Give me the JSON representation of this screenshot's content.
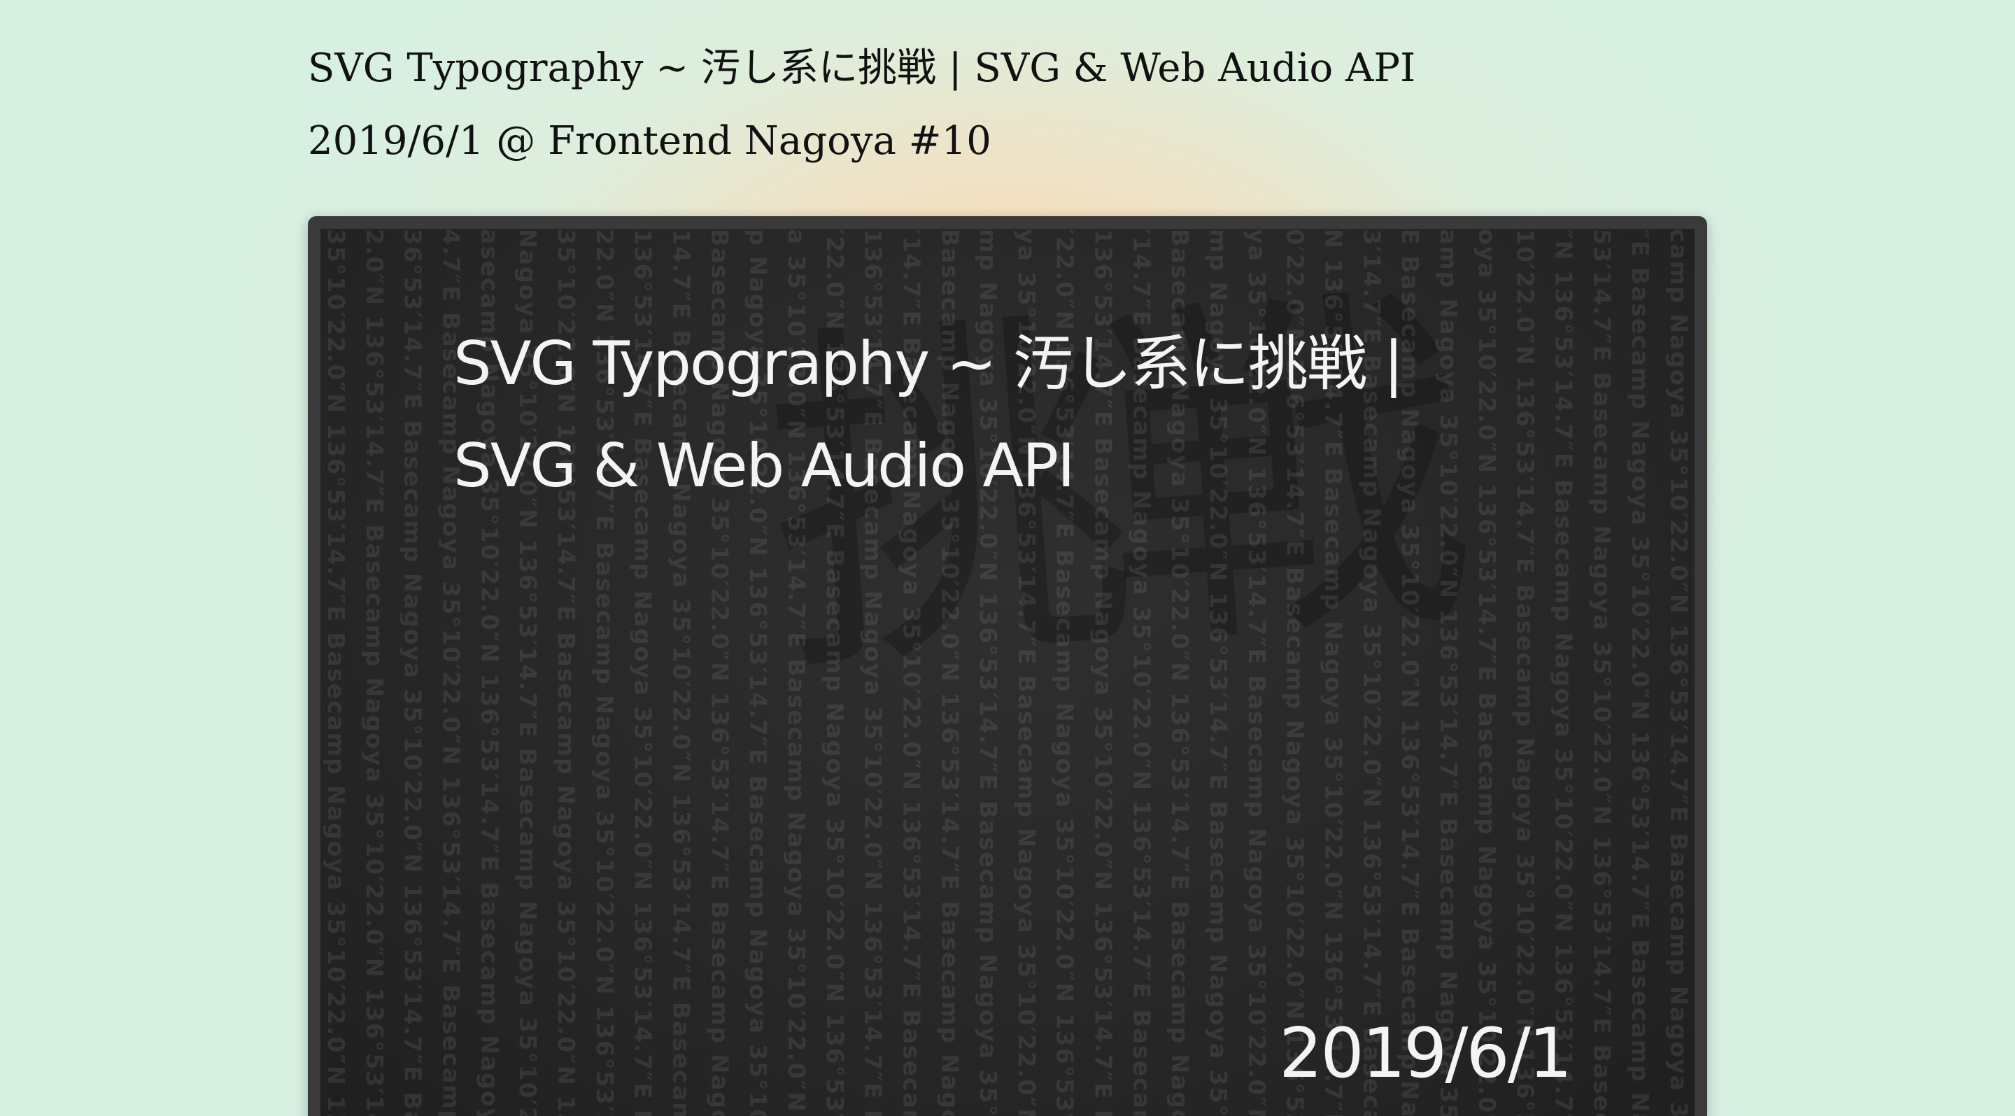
{
  "header": {
    "title": "SVG Typography ~ 汚し系に挑戦 | SVG & Web Audio API",
    "event": "2019/6/1 @ Frontend Nagoya #10"
  },
  "slide": {
    "title_line1": "SVG Typography ~ 汚し系に挑戦 |",
    "title_line2": "SVG & Web Audio API",
    "date": "2019/6/1",
    "background_text": "35°10′22.0″N 136°53′14.7″E Basecamp Nagoya 35°10′22.0″N 136°53′14.7″E Basecamp Nagoya 35°10′22.0″N 136°53′14.7″E Basecamp Nagoya",
    "calligraphy": "挑戦"
  }
}
